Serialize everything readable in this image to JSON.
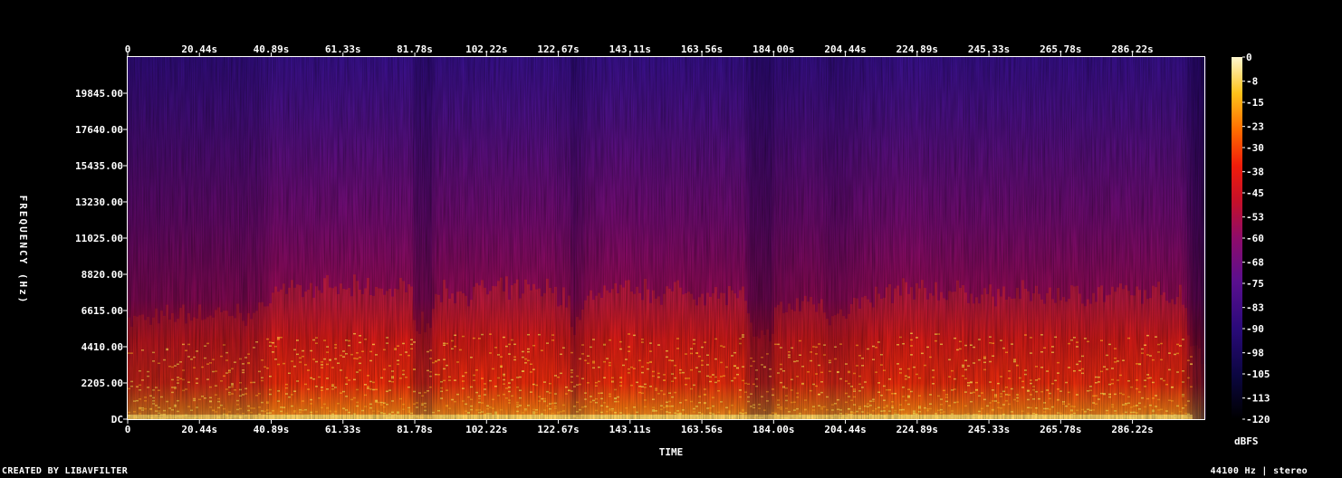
{
  "chart_data": {
    "type": "heatmap",
    "title": "",
    "xlabel": "TIME",
    "ylabel": "FREQUENCY (Hz)",
    "x_unit": "s",
    "x_ticks": [
      "0",
      "20.44s",
      "40.89s",
      "61.33s",
      "81.78s",
      "102.22s",
      "122.67s",
      "143.11s",
      "163.56s",
      "184.00s",
      "204.44s",
      "224.89s",
      "245.33s",
      "265.78s",
      "286.22s"
    ],
    "x_tick_values": [
      0,
      20.44,
      40.89,
      61.33,
      81.78,
      102.22,
      122.67,
      143.11,
      163.56,
      184.0,
      204.44,
      224.89,
      245.33,
      265.78,
      286.22
    ],
    "xlim": [
      0,
      306.7
    ],
    "y_ticks": [
      "DC",
      "2205.00",
      "4410.00",
      "6615.00",
      "8820.00",
      "11025.00",
      "13230.00",
      "15435.00",
      "17640.00",
      "19845.00"
    ],
    "y_tick_values": [
      0,
      2205,
      4410,
      6615,
      8820,
      11025,
      13230,
      15435,
      17640,
      19845
    ],
    "ylim": [
      0,
      22050
    ],
    "colorbar": {
      "label": "dBFS",
      "ticks": [
        "0",
        "-8",
        "-15",
        "-23",
        "-30",
        "-38",
        "-45",
        "-53",
        "-60",
        "-68",
        "-75",
        "-83",
        "-90",
        "-98",
        "-105",
        "-113",
        "-120"
      ],
      "range": [
        -120,
        0
      ]
    },
    "energy_profile": {
      "x": [
        0,
        10,
        12,
        38,
        40,
        80,
        82,
        86,
        88,
        120,
        125,
        127,
        128,
        132,
        135,
        175,
        177,
        182,
        184,
        195,
        200,
        220,
        240,
        250,
        300,
        303,
        306.7
      ],
      "level": [
        0.55,
        0.55,
        0.6,
        0.6,
        0.85,
        0.85,
        0.55,
        0.5,
        0.82,
        0.85,
        0.75,
        0.45,
        0.55,
        0.8,
        0.85,
        0.8,
        0.4,
        0.35,
        0.6,
        0.75,
        0.6,
        0.85,
        0.8,
        0.8,
        0.8,
        0.3,
        0.1
      ]
    }
  },
  "footer": {
    "left": "CREATED BY LIBAVFILTER",
    "right": "44100 Hz | stereo"
  }
}
